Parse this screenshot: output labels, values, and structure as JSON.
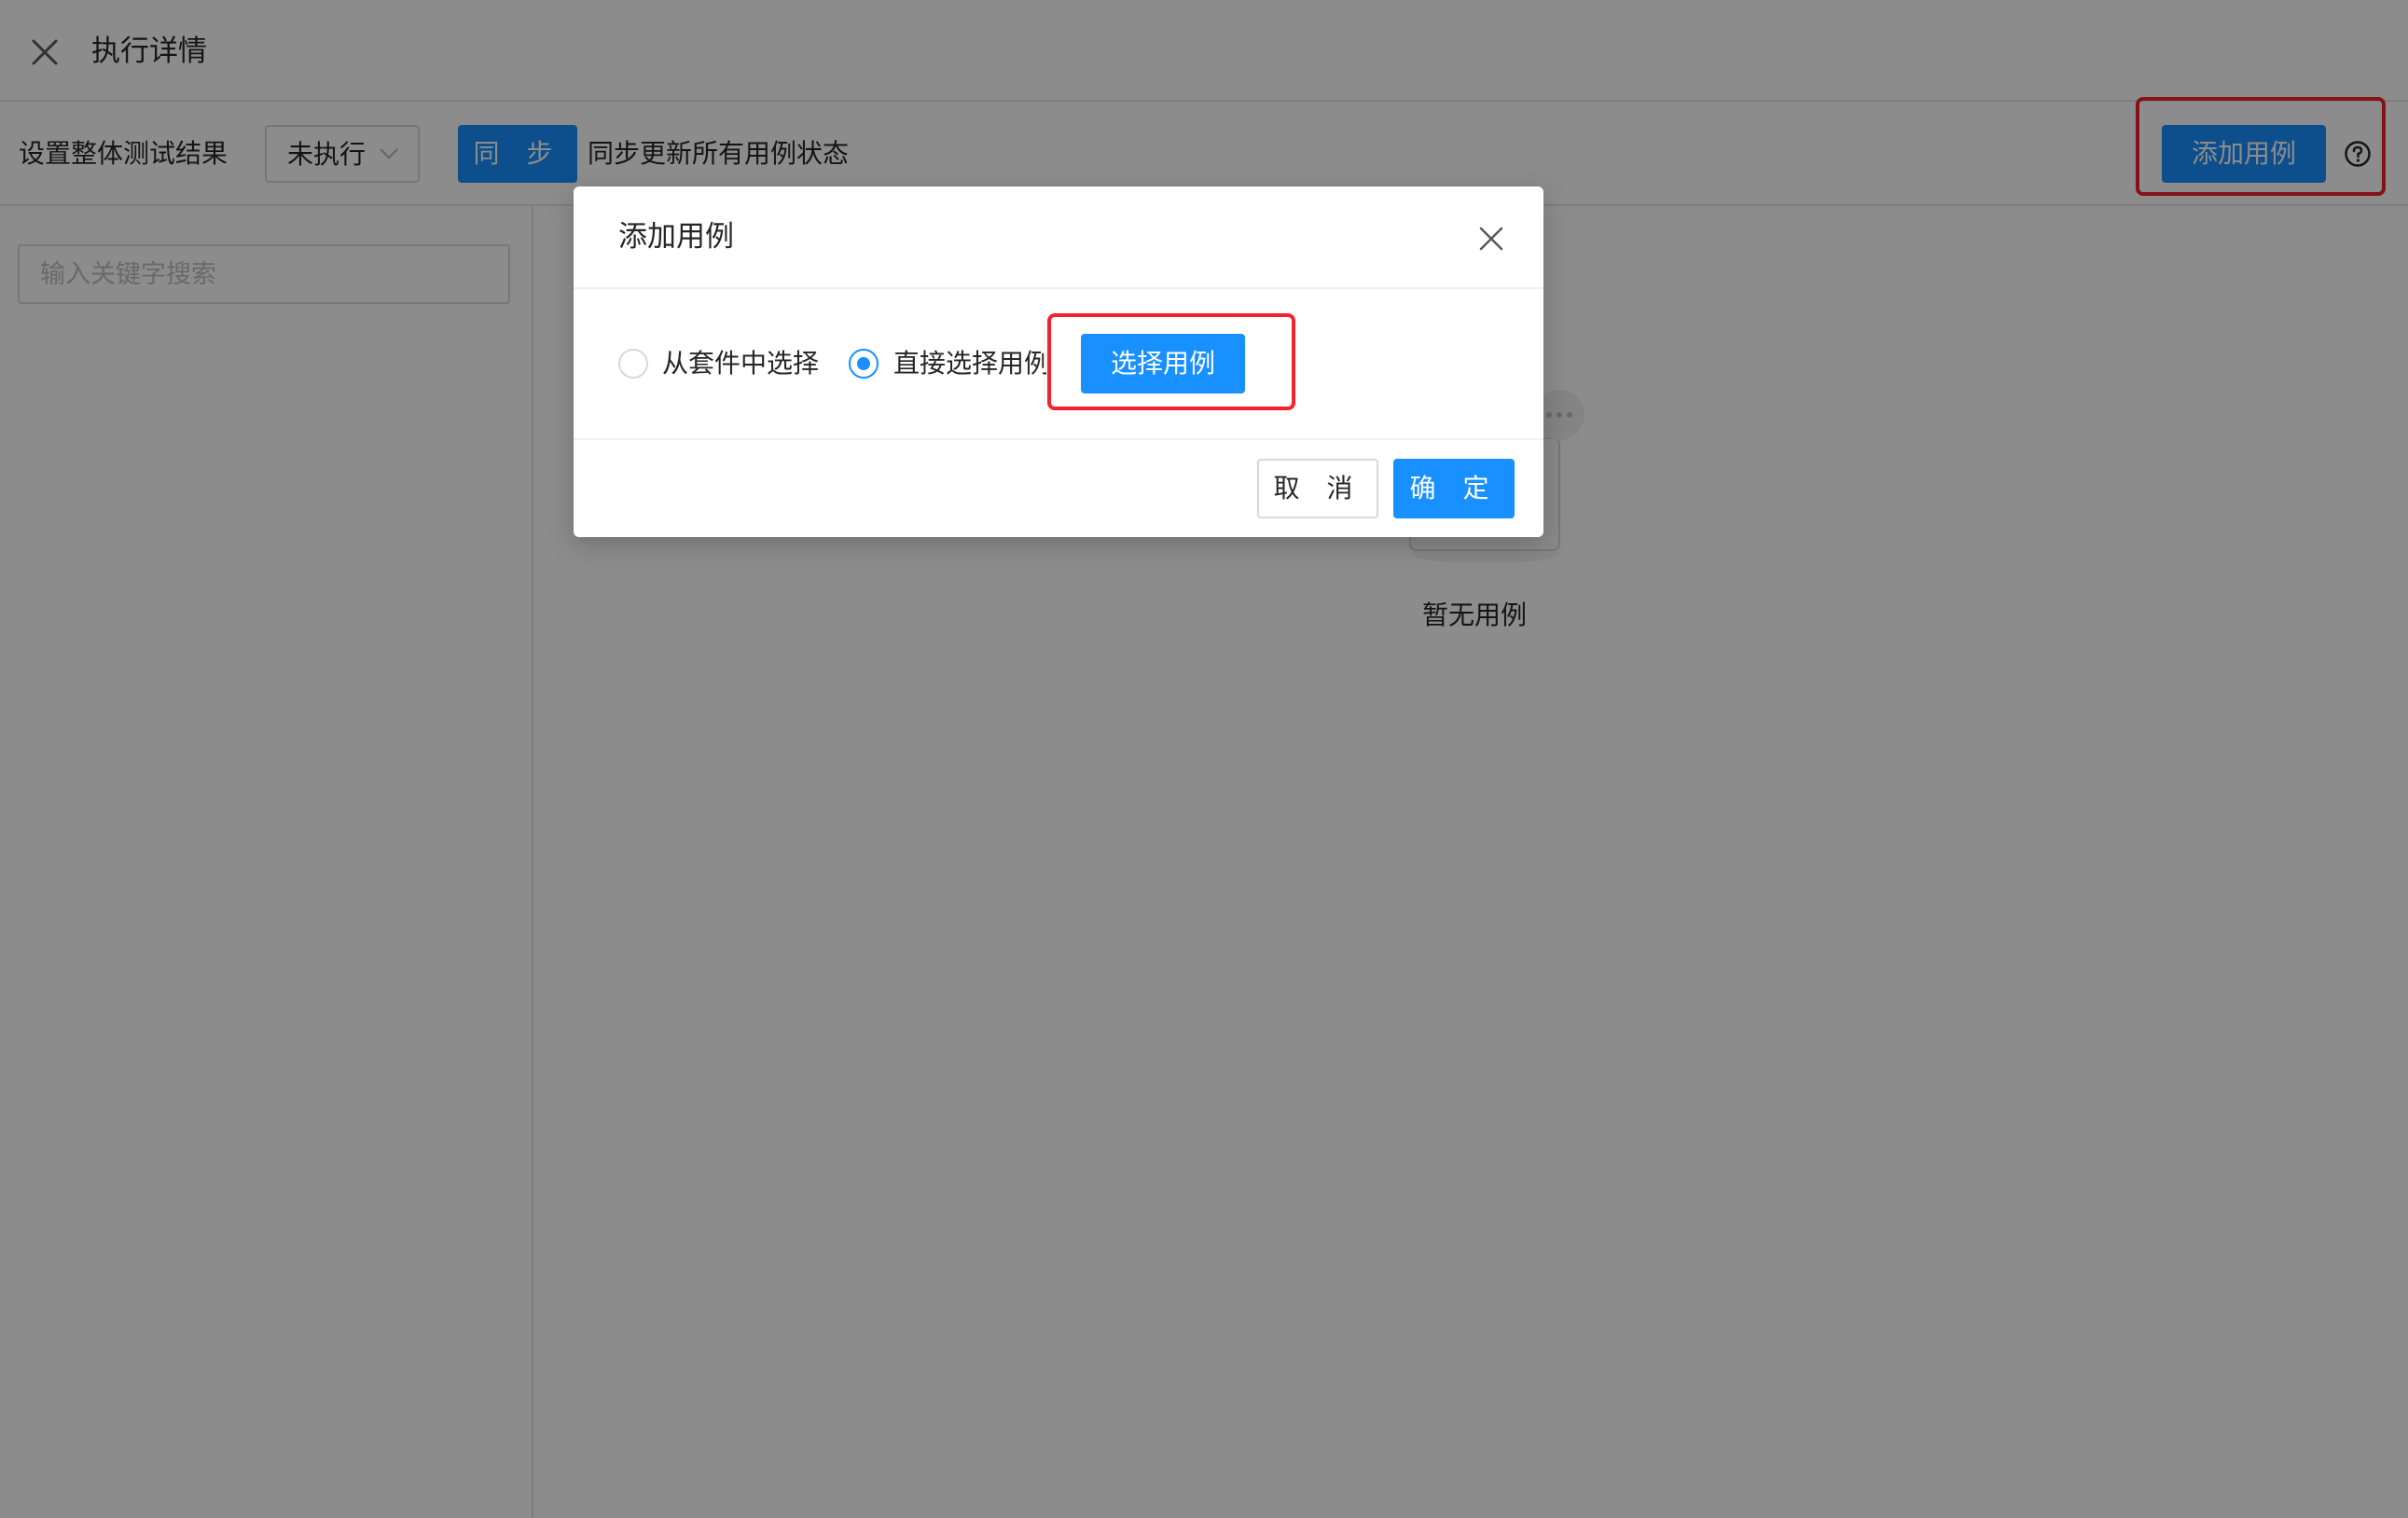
{
  "header": {
    "title": "执行详情",
    "close_icon": "close-icon"
  },
  "toolbar": {
    "set_result_label": "设置整体测试结果",
    "result_select_value": "未执行",
    "sync_button": "同 步",
    "sync_description": "同步更新所有用例状态",
    "add_case_button": "添加用例",
    "help_icon": "question-circle-icon"
  },
  "left_panel": {
    "search_placeholder": "输入关键字搜索"
  },
  "main": {
    "empty_text": "暂无用例"
  },
  "modal": {
    "title": "添加用例",
    "options": [
      {
        "label": "从套件中选择",
        "checked": false
      },
      {
        "label": "直接选择用例",
        "checked": true
      }
    ],
    "select_case_button": "选择用例",
    "cancel_button": "取 消",
    "ok_button": "确 定"
  },
  "colors": {
    "primary": "#1890ff",
    "highlight": "#f5222d"
  }
}
